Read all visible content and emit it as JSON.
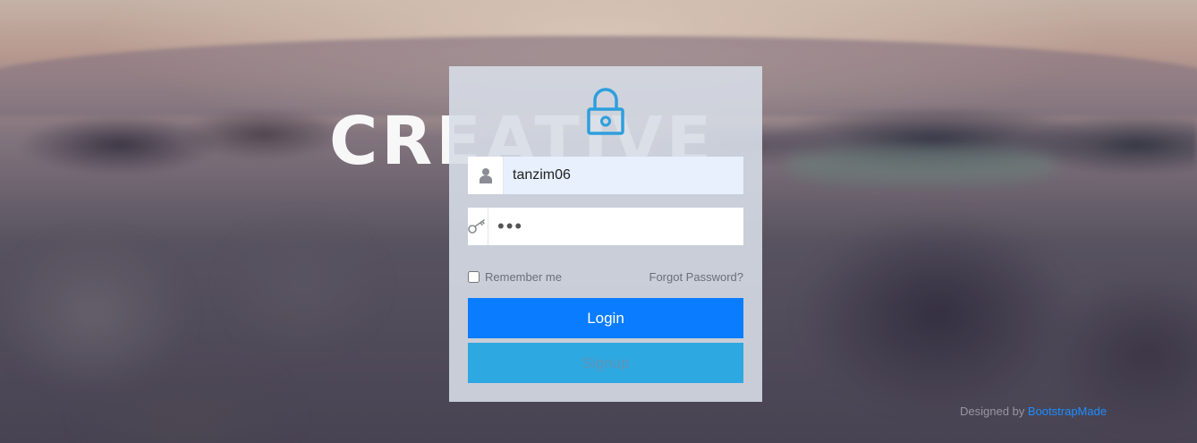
{
  "background": {
    "hero_word": "CREATIVE"
  },
  "login": {
    "icon": "lock-icon",
    "accent_color": "#2e9fdc",
    "username": {
      "icon": "user-icon",
      "value": "tanzim06"
    },
    "password": {
      "icon": "key-icon",
      "value": "abc"
    },
    "remember_label": "Remember me",
    "remember_checked": false,
    "forgot_label": "Forgot Password?",
    "login_label": "Login",
    "signup_label": "Signup",
    "login_color": "#0a7cff",
    "signup_color": "#2ea8e0"
  },
  "footer": {
    "credit_prefix": "Designed by",
    "credit_link": "BootstrapMade"
  }
}
